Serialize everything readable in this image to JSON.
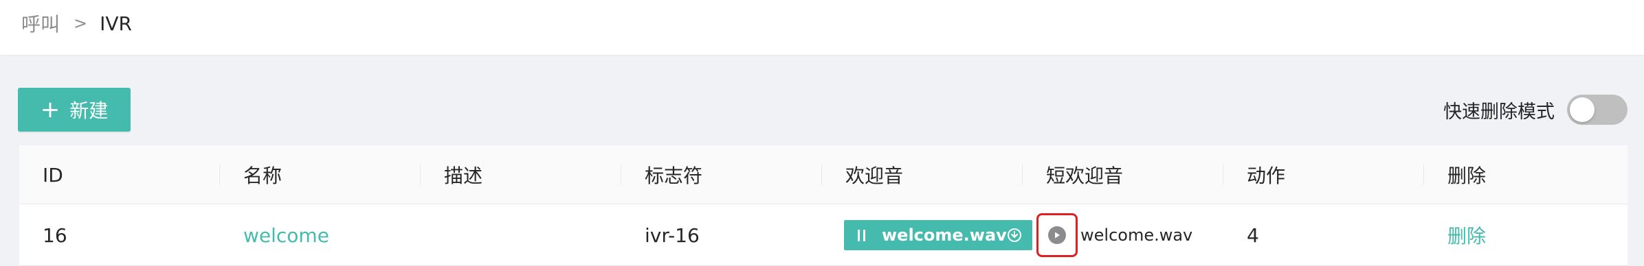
{
  "breadcrumb": {
    "parent": "呼叫",
    "separator": ">",
    "current": "IVR"
  },
  "toolbar": {
    "new_icon": "plus-icon",
    "new_label": "新建",
    "quick_delete_label": "快速删除模式",
    "quick_delete_enabled": false
  },
  "table": {
    "columns": [
      "ID",
      "名称",
      "描述",
      "标志符",
      "欢迎音",
      "短欢迎音",
      "动作",
      "删除"
    ],
    "rows": [
      {
        "id": "16",
        "name": "welcome",
        "description": "",
        "identifier": "ivr-16",
        "welcome_audio": "welcome.wav",
        "welcome_audio_state": "playing",
        "short_welcome_audio": "welcome.wav",
        "action": "4",
        "delete_label": "删除"
      }
    ]
  },
  "colors": {
    "accent": "#44bbad",
    "highlight": "#e02020",
    "switch_off": "#bfbfbf"
  }
}
